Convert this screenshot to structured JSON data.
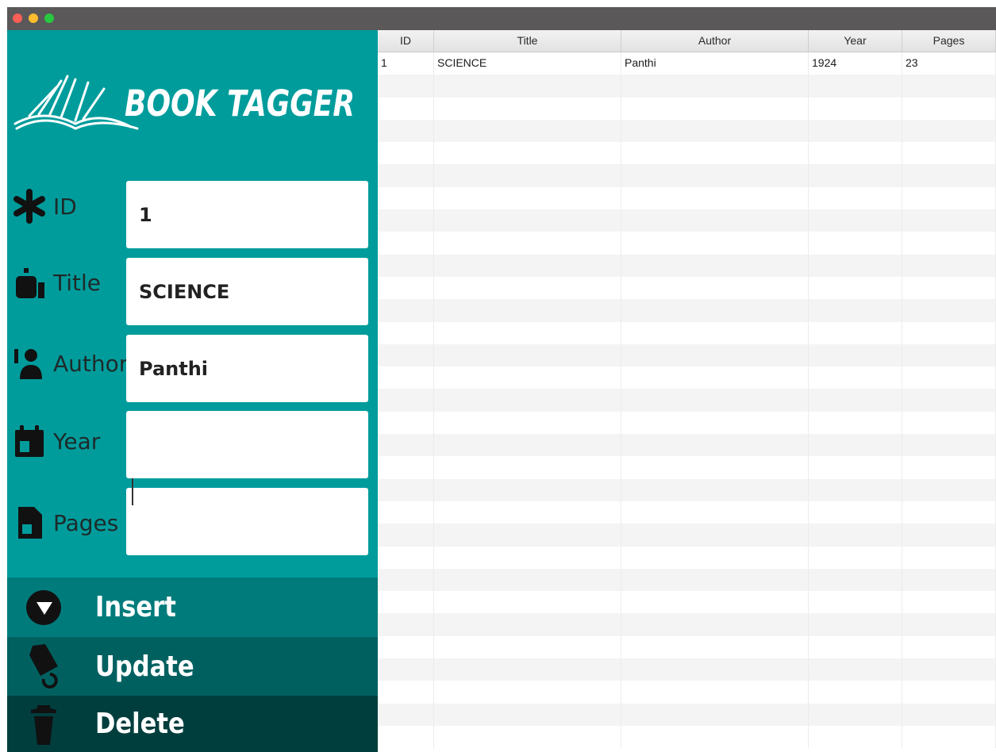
{
  "window": {
    "controls": [
      "close",
      "minimize",
      "maximize"
    ]
  },
  "brand": {
    "title": "BOOK TAGGER",
    "logo_icon": "open-book-icon"
  },
  "form": {
    "fields": [
      {
        "key": "id",
        "label": "ID",
        "icon": "asterisk-icon",
        "value": "1"
      },
      {
        "key": "title",
        "label": "Title",
        "icon": "title-icon",
        "value": "SCIENCE"
      },
      {
        "key": "author",
        "label": "Author",
        "icon": "author-icon",
        "value": "Panthi"
      },
      {
        "key": "year",
        "label": "Year",
        "icon": "calendar-icon",
        "value": ""
      },
      {
        "key": "pages",
        "label": "Pages",
        "icon": "page-icon",
        "value": ""
      }
    ]
  },
  "actions": {
    "insert": {
      "label": "Insert",
      "icon": "insert-icon"
    },
    "update": {
      "label": "Update",
      "icon": "update-icon"
    },
    "delete": {
      "label": "Delete",
      "icon": "trash-icon"
    }
  },
  "table": {
    "columns": [
      "ID",
      "Title",
      "Author",
      "Year",
      "Pages"
    ],
    "rows": [
      [
        "1",
        "SCIENCE",
        "Panthi",
        "1924",
        "23"
      ]
    ]
  },
  "colors": {
    "sidebar": "#009c9c",
    "insert": "#007b7b",
    "update": "#006060",
    "delete": "#003e3e",
    "titlebar": "#5a5858"
  }
}
